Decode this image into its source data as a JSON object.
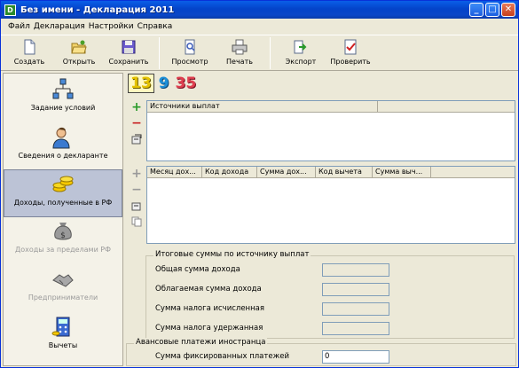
{
  "window": {
    "title": "Без имени - Декларация 2011",
    "icon_letter": "D"
  },
  "menu": [
    "Файл",
    "Декларация",
    "Настройки",
    "Справка"
  ],
  "toolbar": {
    "create": "Создать",
    "open": "Открыть",
    "save": "Сохранить",
    "preview": "Просмотр",
    "print": "Печать",
    "export": "Экспорт",
    "check": "Проверить"
  },
  "sidebar": [
    {
      "label": "Задание условий",
      "state": "normal"
    },
    {
      "label": "Сведения о декларанте",
      "state": "normal"
    },
    {
      "label": "Доходы, полученные в РФ",
      "state": "active"
    },
    {
      "label": "Доходы за пределами РФ",
      "state": "disabled"
    },
    {
      "label": "Предприниматели",
      "state": "disabled"
    },
    {
      "label": "Вычеты",
      "state": "normal"
    }
  ],
  "rate_tabs": [
    "13",
    "9",
    "35"
  ],
  "sources_grid": {
    "headers": [
      "Источники выплат"
    ],
    "rows": []
  },
  "income_grid": {
    "headers": [
      "Месяц дох...",
      "Код дохода",
      "Сумма дох...",
      "Код вычета",
      "Сумма выч..."
    ],
    "rows": []
  },
  "totals": {
    "legend": "Итоговые суммы по источнику выплат",
    "rows": [
      {
        "label": "Общая сумма дохода",
        "value": ""
      },
      {
        "label": "Облагаемая сумма дохода",
        "value": ""
      },
      {
        "label": "Сумма налога исчисленная",
        "value": ""
      },
      {
        "label": "Сумма налога удержанная",
        "value": ""
      }
    ]
  },
  "advance": {
    "legend": "Авансовые платежи иностранца",
    "label": "Сумма фиксированных платежей",
    "value": "0"
  },
  "colors": {
    "titlebar": "#0a5ee8",
    "active_side": "#bcc3d6",
    "add": "#2a9a2a",
    "remove": "#c82020"
  }
}
